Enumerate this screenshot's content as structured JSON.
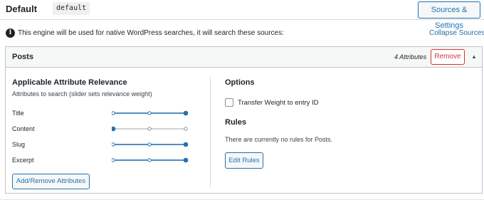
{
  "engine": {
    "title": "Default",
    "code": "default",
    "sources_button": "Sources & Settings"
  },
  "notice": {
    "icon": "info-icon",
    "text": "This engine will be used for native WordPress searches, it will search these sources:",
    "collapse_link": "Collapse Sources"
  },
  "source": {
    "title": "Posts",
    "attribute_count": "4 Attributes",
    "remove_button": "Remove",
    "toggle_icon": "▲",
    "relevance": {
      "title": "Applicable Attribute Relevance",
      "subtitle": "Attributes to search (slider sets relevance weight)",
      "attributes": [
        {
          "label": "Title",
          "weight": 1.0
        },
        {
          "label": "Content",
          "weight": 0.0
        },
        {
          "label": "Slug",
          "weight": 1.0
        },
        {
          "label": "Excerpt",
          "weight": 1.0
        }
      ],
      "add_remove_button": "Add/Remove Attributes"
    },
    "options": {
      "title": "Options",
      "transfer_weight_label": "Transfer Weight to entry ID",
      "transfer_weight_checked": false
    },
    "rules": {
      "title": "Rules",
      "empty_text": "There are currently no rules for Posts.",
      "edit_button": "Edit Rules"
    }
  },
  "colors": {
    "accent": "#2271b1",
    "danger": "#d63638",
    "slider_inactive": "#c3c4c7"
  }
}
